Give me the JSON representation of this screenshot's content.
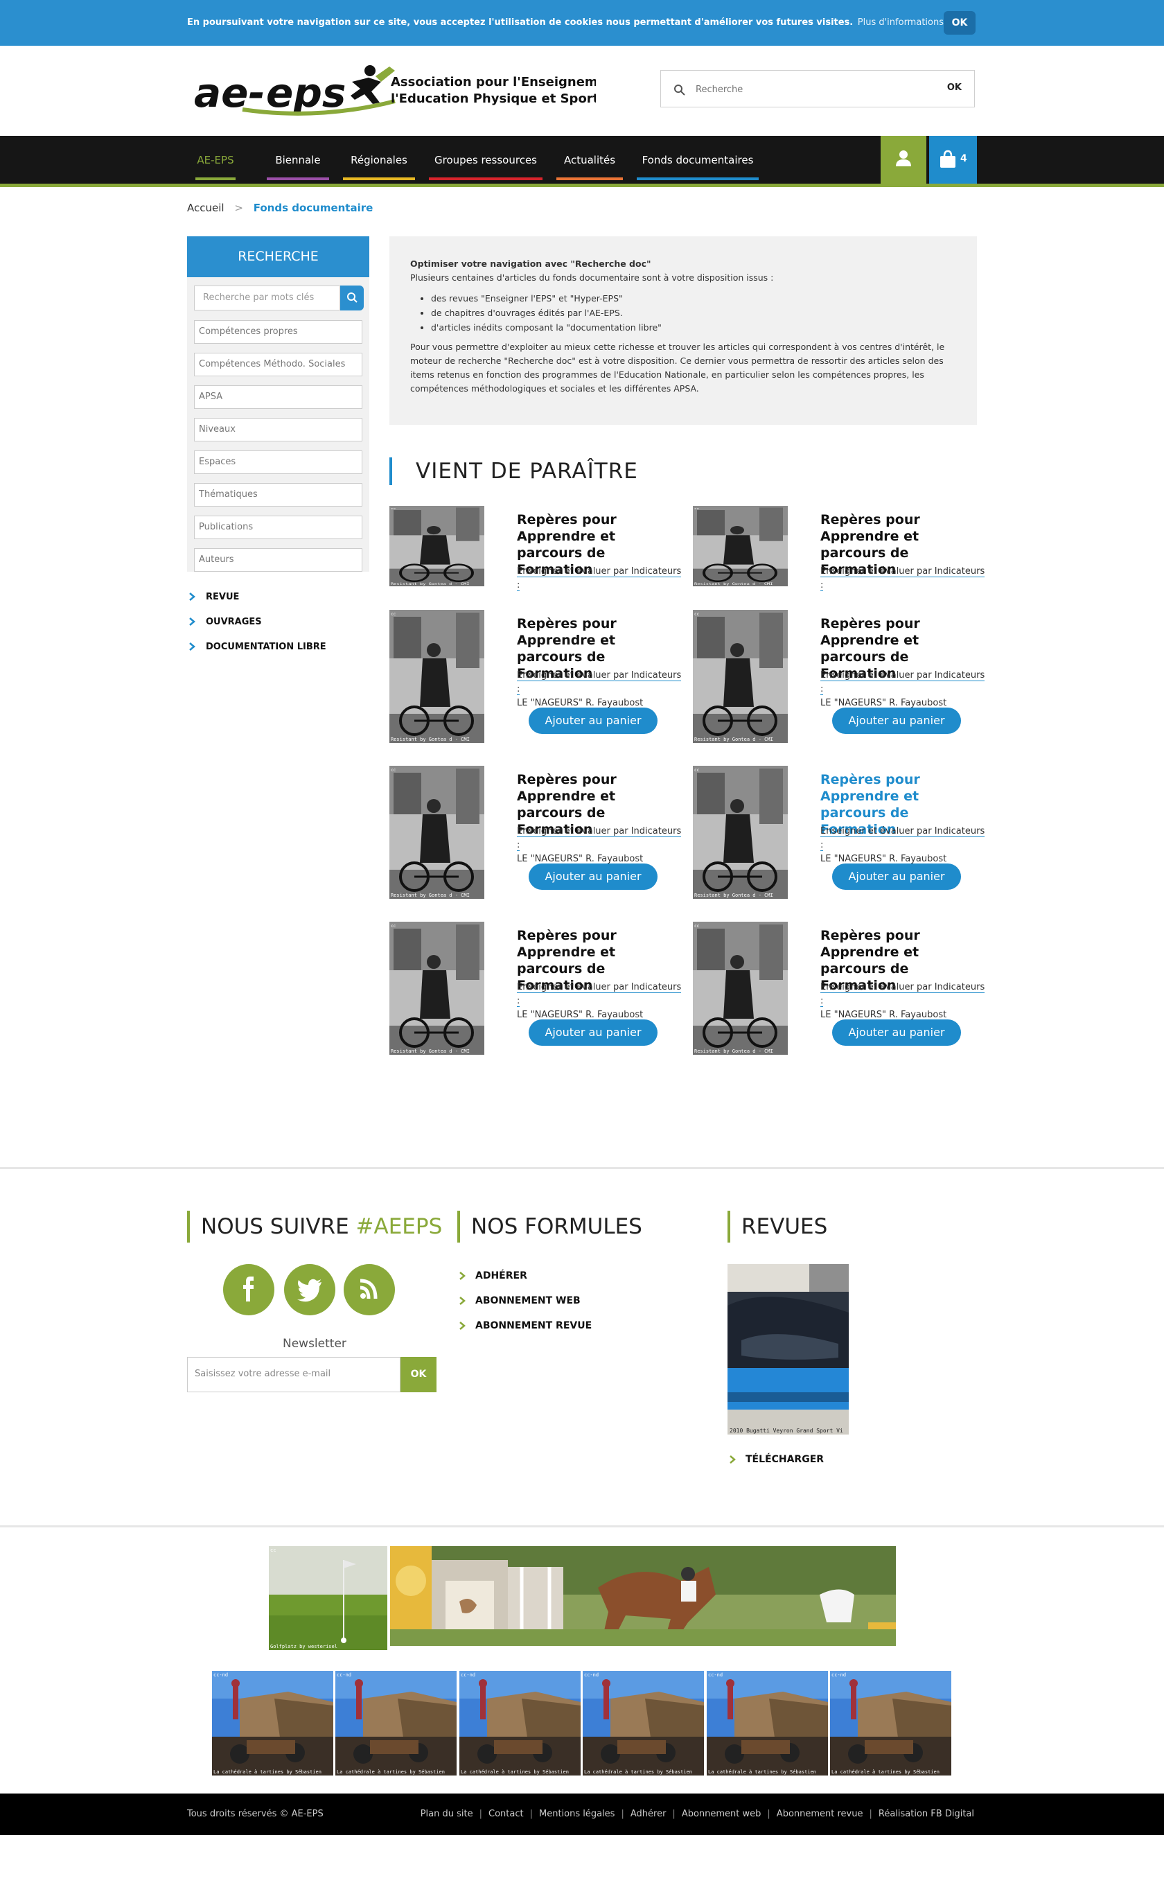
{
  "cookie": {
    "text": "En poursuivant votre navigation sur ce site, vous acceptez l'utilisation de cookies nous permettant d'améliorer vos futures visites.",
    "link": "Plus d'informations >>",
    "ok": "OK"
  },
  "logo": {
    "mark": "ae-eps",
    "line1": "Association pour l'Enseignement",
    "line2": "l'Education Physique et Sportive"
  },
  "search": {
    "placeholder": "Recherche",
    "ok": "OK"
  },
  "nav": {
    "items": [
      {
        "label": "AE-EPS",
        "color": "#8aa93a"
      },
      {
        "label": "Biennale",
        "color": "#9b4fa8"
      },
      {
        "label": "Régionales",
        "color": "#e7b823"
      },
      {
        "label": "Groupes ressources",
        "color": "#d7242c"
      },
      {
        "label": "Actualités",
        "color": "#ea7436"
      },
      {
        "label": "Fonds documentaires",
        "color": "#1f8ccc"
      }
    ],
    "cart_count": "4"
  },
  "breadcrumb": {
    "home": "Accueil",
    "separator": ">",
    "current": "Fonds documentaire"
  },
  "sidebar": {
    "title": "RECHERCHE",
    "keyword_placeholder": "Recherche par mots clés",
    "filters": [
      "Compétences propres",
      "Compétences Méthodo. Sociales",
      "APSA",
      "Niveaux",
      "Espaces",
      "Thématiques",
      "Publications",
      "Auteurs"
    ],
    "links": [
      "REVUE",
      "OUVRAGES",
      "DOCUMENTATION LIBRE"
    ]
  },
  "info": {
    "title": "Optimiser votre navigation avec \"Recherche doc\"",
    "intro": "Plusieurs centaines d'articles du fonds documentaire sont à votre disposition issus :",
    "bullets": [
      "des revues \"Enseigner l'EPS\" et \"Hyper-EPS\"",
      "de chapitres d'ouvrages édités par l'AE-EPS.",
      "d'articles inédits composant la \"documentation libre\""
    ],
    "paragraph": "Pour vous permettre d'exploiter au mieux cette richesse et trouver les articles qui correspondent à vos centres d'intérêt, le moteur de recherche \"Recherche doc\" est à votre disposition. Ce dernier vous permettra de ressortir des articles selon des items retenus en fonction des programmes de l'Education Nationale, en particulier selon les compétences propres, les compétences méthodologiques et sociales et les différentes APSA."
  },
  "section_title": "VIENT DE PARAÎTRE",
  "products": [
    {
      "title": "Repères pour Apprendre et parcours de Formation",
      "subtitle": "Enseigner et évaluer par Indicateurs :",
      "author": "",
      "button": ""
    },
    {
      "title": "Repères pour Apprendre et parcours de Formation",
      "subtitle": "Enseigner et évaluer par Indicateurs :",
      "author": "",
      "button": ""
    },
    {
      "title": "Repères pour Apprendre et parcours de Formation",
      "subtitle": "Enseigner et évaluer par Indicateurs :",
      "author": "LE \"NAGEURS\" R. Fayaubost",
      "button": "Ajouter au panier"
    },
    {
      "title": "Repères pour Apprendre et parcours de Formation",
      "subtitle": "Enseigner et évaluer par Indicateurs :",
      "author": "LE \"NAGEURS\" R. Fayaubost",
      "button": "Ajouter au panier"
    },
    {
      "title": "Repères pour Apprendre et parcours de Formation",
      "subtitle": "Enseigner et évaluer par Indicateurs :",
      "author": "LE \"NAGEURS\" R. Fayaubost",
      "button": "Ajouter au panier"
    },
    {
      "title": "Repères pour Apprendre et parcours de Formation",
      "subtitle": "Enseigner et évaluer par Indicateurs :",
      "author": "LE \"NAGEURS\" R. Fayaubost",
      "button": "Ajouter au panier"
    },
    {
      "title": "Repères pour Apprendre et parcours de Formation",
      "subtitle": "Enseigner et évaluer par Indicateurs :",
      "author": "LE \"NAGEURS\" R. Fayaubost",
      "button": "Ajouter au panier"
    },
    {
      "title": "Repères pour Apprendre et parcours de Formation",
      "subtitle": "Enseigner et évaluer par Indicateurs :",
      "author": "LE \"NAGEURS\" R. Fayaubost",
      "button": "Ajouter au panier"
    }
  ],
  "image_caption": "Resistant by Gontea d - CMI",
  "footer": {
    "follow_title": "NOUS SUIVRE",
    "follow_tag": "#AEEPS",
    "newsletter_label": "Newsletter",
    "newsletter_placeholder": "Saisissez votre adresse e-mail",
    "newsletter_ok": "OK",
    "formules_title": "NOS FORMULES",
    "formules": [
      "ADHÉRER",
      "ABONNEMENT WEB",
      "ABONNEMENT REVUE"
    ],
    "revues_title": "REVUES",
    "revue_caption": "2010 Bugatti Veyron Grand Sport Vi",
    "download": "TÉLÉCHARGER"
  },
  "partners": {
    "golf_caption": "Golfplatz by westerisel",
    "thumb_caption": "La cathédrale à tartines by Sébastien"
  },
  "bottom": {
    "copyright": "Tous droits réservés © AE-EPS",
    "links": [
      "Plan du site",
      "Contact",
      "Mentions légales",
      "Adhérer",
      "Abonnement web",
      "Abonnement revue",
      "Réalisation FB Digital"
    ]
  },
  "colors": {
    "blue": "#1f8ccc",
    "green": "#8aa93a",
    "dark": "#161616"
  }
}
